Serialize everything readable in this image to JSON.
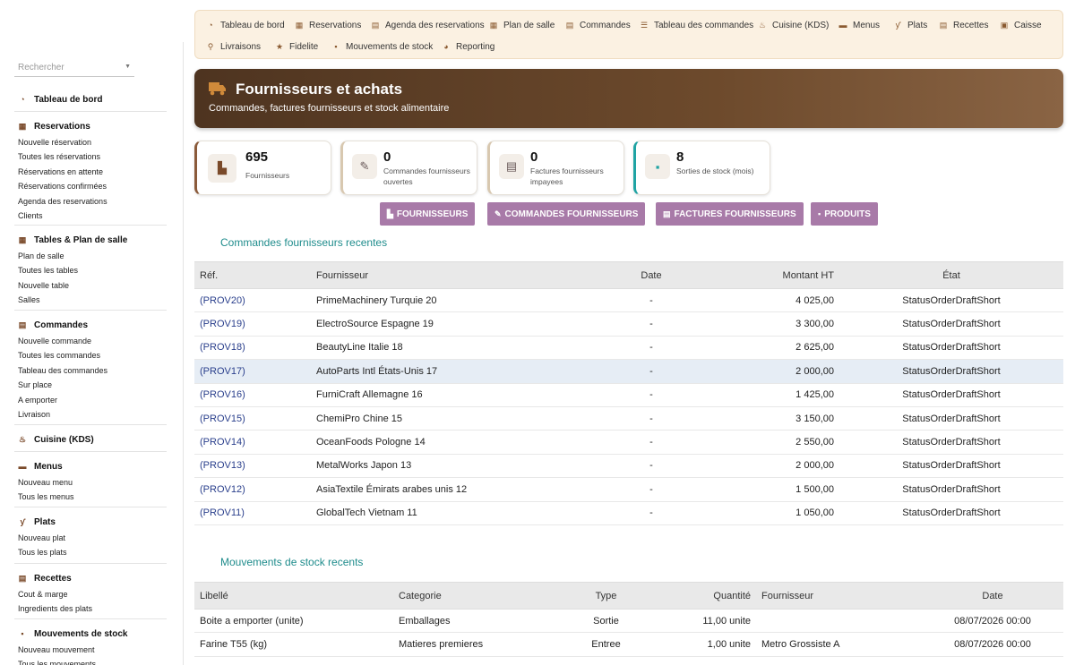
{
  "search": {
    "placeholder": "Rechercher"
  },
  "sidebar": {
    "groups": [
      {
        "title": "Tableau de bord",
        "icon": "gauge-icon",
        "items": []
      },
      {
        "title": "Reservations",
        "icon": "calendar-icon",
        "items": [
          "Nouvelle réservation",
          "Toutes les réservations",
          "Réservations en attente",
          "Réservations confirmées",
          "Agenda des reservations",
          "Clients"
        ]
      },
      {
        "title": "Tables & Plan de salle",
        "icon": "grid-icon",
        "items": [
          "Plan de salle",
          "Toutes les tables",
          "Nouvelle table",
          "Salles"
        ]
      },
      {
        "title": "Commandes",
        "icon": "receipt-icon",
        "items": [
          "Nouvelle commande",
          "Toutes les commandes",
          "Tableau des commandes",
          "Sur place",
          "A emporter",
          "Livraison"
        ]
      },
      {
        "title": "Cuisine (KDS)",
        "icon": "flame-icon",
        "items": []
      },
      {
        "title": "Menus",
        "icon": "book-icon",
        "items": [
          "Nouveau menu",
          "Tous les menus"
        ]
      },
      {
        "title": "Plats",
        "icon": "utensils-icon",
        "items": [
          "Nouveau plat",
          "Tous les plats"
        ]
      },
      {
        "title": "Recettes",
        "icon": "recipe-icon",
        "items": [
          "Cout & marge",
          "Ingredients des plats"
        ]
      },
      {
        "title": "Mouvements de stock",
        "icon": "boxes-icon",
        "items": [
          "Nouveau mouvement",
          "Tous les mouvements"
        ]
      }
    ]
  },
  "topnav": {
    "items": [
      {
        "label": "Tableau de bord",
        "icon": "gauge-icon"
      },
      {
        "label": "Reservations",
        "icon": "calendar-icon"
      },
      {
        "label": "Agenda des reservations",
        "icon": "agenda-icon"
      },
      {
        "label": "Plan de salle",
        "icon": "grid-icon"
      },
      {
        "label": "Commandes",
        "icon": "receipt-icon"
      },
      {
        "label": "Tableau des commandes",
        "icon": "list-icon"
      },
      {
        "label": "Cuisine (KDS)",
        "icon": "flame-icon"
      },
      {
        "label": "Menus",
        "icon": "book-icon"
      },
      {
        "label": "Plats",
        "icon": "utensils-icon"
      },
      {
        "label": "Recettes",
        "icon": "recipe-icon"
      },
      {
        "label": "Caisse",
        "icon": "register-icon"
      },
      {
        "label": "Livraisons",
        "icon": "scooter-icon"
      },
      {
        "label": "Fidelite",
        "icon": "star-icon"
      },
      {
        "label": "Mouvements de stock",
        "icon": "boxes-icon"
      },
      {
        "label": "Reporting",
        "icon": "pie-icon"
      }
    ]
  },
  "banner": {
    "title": "Fournisseurs et achats",
    "subtitle": "Commandes, factures fournisseurs et stock alimentaire",
    "icon": "truck-icon"
  },
  "kpis": [
    {
      "value": "695",
      "label": "Fournisseurs",
      "icon": "factory-icon",
      "accent": "#8a5a3a"
    },
    {
      "value": "0",
      "label": "Commandes fournisseurs ouvertes",
      "icon": "order-edit-icon",
      "accent": "#d8c8b0"
    },
    {
      "value": "0",
      "label": "Factures fournisseurs impayees",
      "icon": "invoice-icon",
      "accent": "#d8c8b0"
    },
    {
      "value": "8",
      "label": "Sorties de stock (mois)",
      "icon": "boxes-icon",
      "accent": "#1fa3a3"
    }
  ],
  "buttons": [
    {
      "label": "FOURNISSEURS",
      "icon": "factory-icon"
    },
    {
      "label": "COMMANDES FOURNISSEURS",
      "icon": "order-edit-icon"
    },
    {
      "label": "FACTURES FOURNISSEURS",
      "icon": "invoice-icon"
    },
    {
      "label": "PRODUITS",
      "icon": "boxes-icon"
    }
  ],
  "orders": {
    "title": "Commandes fournisseurs recentes",
    "columns": [
      "Réf.",
      "Fournisseur",
      "Date",
      "Montant HT",
      "État"
    ],
    "rows": [
      [
        "(PROV20)",
        "PrimeMachinery Turquie 20",
        "-",
        "4 025,00",
        "StatusOrderDraftShort"
      ],
      [
        "(PROV19)",
        "ElectroSource Espagne 19",
        "-",
        "3 300,00",
        "StatusOrderDraftShort"
      ],
      [
        "(PROV18)",
        "BeautyLine Italie 18",
        "-",
        "2 625,00",
        "StatusOrderDraftShort"
      ],
      [
        "(PROV17)",
        "AutoParts Intl États-Unis 17",
        "-",
        "2 000,00",
        "StatusOrderDraftShort"
      ],
      [
        "(PROV16)",
        "FurniCraft Allemagne 16",
        "-",
        "1 425,00",
        "StatusOrderDraftShort"
      ],
      [
        "(PROV15)",
        "ChemiPro Chine 15",
        "-",
        "3 150,00",
        "StatusOrderDraftShort"
      ],
      [
        "(PROV14)",
        "OceanFoods Pologne 14",
        "-",
        "2 550,00",
        "StatusOrderDraftShort"
      ],
      [
        "(PROV13)",
        "MetalWorks Japon 13",
        "-",
        "2 000,00",
        "StatusOrderDraftShort"
      ],
      [
        "(PROV12)",
        "AsiaTextile Émirats arabes unis 12",
        "-",
        "1 500,00",
        "StatusOrderDraftShort"
      ],
      [
        "(PROV11)",
        "GlobalTech Vietnam 11",
        "-",
        "1 050,00",
        "StatusOrderDraftShort"
      ]
    ],
    "highlight_row": 3
  },
  "stock": {
    "title": "Mouvements de stock recents",
    "columns": [
      "Libellé",
      "Categorie",
      "Type",
      "Quantité",
      "Fournisseur",
      "Date"
    ],
    "rows": [
      [
        "Boite a emporter (unite)",
        "Emballages",
        "Sortie",
        "11,00 unite",
        "",
        "08/07/2026 00:00"
      ],
      [
        "Farine T55 (kg)",
        "Matieres premieres",
        "Entree",
        "1,00 unite",
        "Metro Grossiste A",
        "08/07/2026 00:00"
      ]
    ]
  }
}
